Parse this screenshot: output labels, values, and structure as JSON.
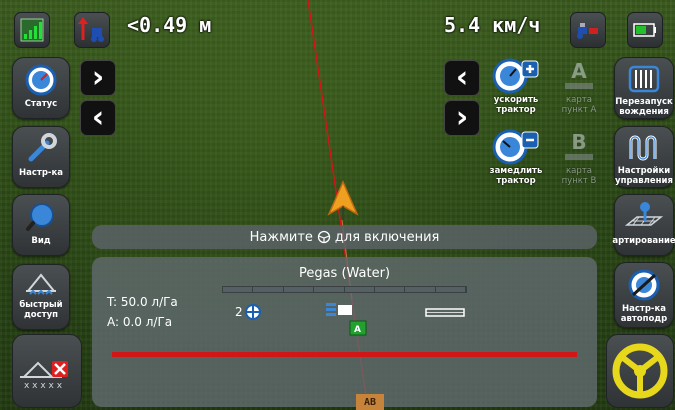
{
  "top": {
    "distance_text": "<0.49 м",
    "speed_text": "5.4 км/ч",
    "icons": [
      "signal-icon",
      "tractor-icon",
      "vehicle-status-icon",
      "battery-icon"
    ]
  },
  "left_panel": {
    "status_label": "Статус",
    "settings_label": "Настр-ка",
    "view_label": "Вид",
    "quick_access_label": "быстрый\nдоступ"
  },
  "nudge": {
    "right_arrow": "›",
    "left_arrow": "‹"
  },
  "center_controls": {
    "speed_up_label": "ускорить\nтрактор",
    "slow_down_label": "замедлить\nтрактор",
    "point_a_label": "карта\nпункт А",
    "point_b_label": "карта\nпункт В",
    "point_a_letter": "A",
    "point_b_letter": "B"
  },
  "right_panel": {
    "restart_label": "Перезапуск\nвождения",
    "steering_settings_label": "Настройки\nуправления",
    "marking_label": "артирование",
    "autosteer_setup_label": "Настр-ка\nавтоподр"
  },
  "banner": {
    "text_before": "Нажмите",
    "text_after": "для включения"
  },
  "implement": {
    "name": "Pegas (Water)",
    "target_rate": "T: 50.0 л/Га",
    "actual_rate": "A: 0.0 л/Га",
    "section_count": "2"
  },
  "guidance": {
    "ab_label": "AB"
  },
  "colors": {
    "guide_line": "#d01616",
    "accent_orange": "#f0a020",
    "steering_yellow": "#e8d81c",
    "active_green": "#22c02a"
  }
}
